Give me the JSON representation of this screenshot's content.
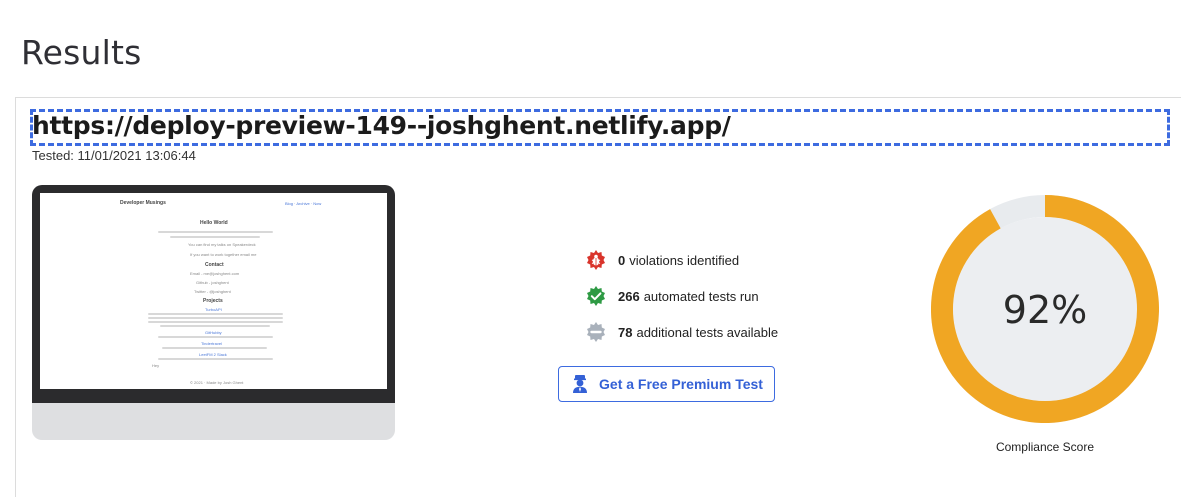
{
  "page": {
    "title": "Results"
  },
  "result": {
    "url": "https://deploy-preview-149--joshghent.netlify.app/",
    "tested": "Tested: 11/01/2021 13:06:44"
  },
  "thumbnail": {
    "site_name": "Developer Musings",
    "nav": "Blog · Archive · Now",
    "heading": "Hello World",
    "intro": "I'm Josh. I make robust apps for the web. I build TurboAPI - application performance monitoring made simple. Also organise Birmingham",
    "talks": "You can find my talks on Speakerdeck",
    "work": "If you want to work together email me",
    "contact_heading": "Contact",
    "contact_email": "Email - me@joshghent.com",
    "contact_github": "Github - joshghent",
    "contact_twitter": "Twitter - @joshghent",
    "projects_heading": "Projects",
    "project_1": "TurboAPI",
    "project_2": "GitHubby",
    "project_3": "Tindertravel",
    "project_4": "LeetFM 2 Slack",
    "hey": "Hey",
    "footer": "© 2021 · Made by Josh Ghent"
  },
  "stats": {
    "violations_count": "0",
    "violations_label": "violations identified",
    "tests_count": "266",
    "tests_label": "automated tests run",
    "additional_count": "78",
    "additional_label": "additional tests available",
    "icons": [
      "bug-icon",
      "check-badge-icon",
      "minus-badge-icon"
    ],
    "colors": {
      "violation": "#d9342b",
      "pass": "#2e9a44",
      "neutral": "#a9b1bb"
    }
  },
  "premium_button": {
    "label": "Get a Free Premium Test",
    "icon": "agent-icon",
    "color": "#3461d6"
  },
  "compliance": {
    "score_text": "92%",
    "score_value": 92,
    "label": "Compliance Score",
    "colors": {
      "arc": "#f0a623",
      "track": "#e8ebee",
      "inner": "#eceef1"
    }
  }
}
